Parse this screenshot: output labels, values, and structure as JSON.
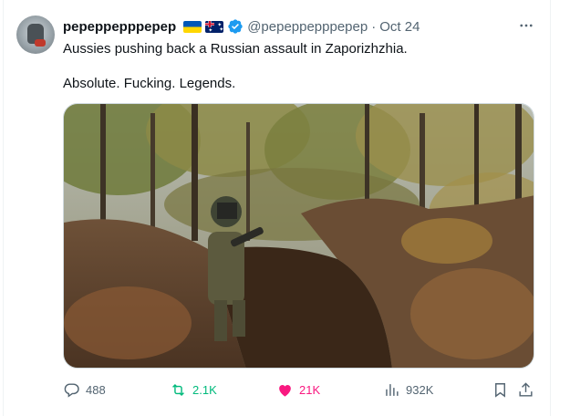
{
  "tweet": {
    "author_name": "pepeppepppepep",
    "handle": "@pepeppepppepep",
    "separator": "·",
    "timestamp": "Oct 24",
    "flags": [
      "ukraine-flag-icon",
      "australia-flag-icon"
    ],
    "verified": true,
    "text_line1": "Aussies pushing back a Russian assault in Zaporizhzhia.",
    "text_line2": "Absolute. Fucking. Legends.",
    "media": {
      "type": "video-still",
      "description_icon": "trench-forest-image"
    },
    "stats": {
      "replies": "488",
      "retweets": "2.1K",
      "likes": "21K",
      "views": "932K"
    }
  },
  "colors": {
    "text": "#0f1419",
    "secondary": "#536471",
    "verified": "#1d9bf0",
    "retweet_active": "#00ba7c",
    "like_active": "#f91880"
  }
}
